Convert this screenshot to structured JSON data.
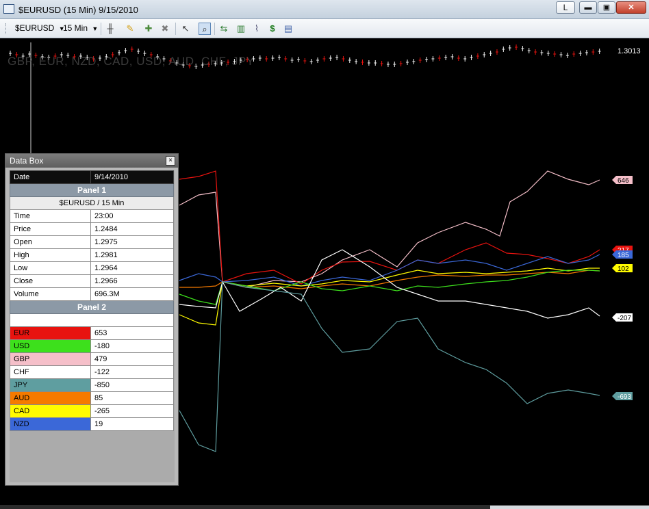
{
  "window": {
    "title": "$EURUSD (15 Min)  9/15/2010",
    "badge": "L",
    "minimize": "▬",
    "maximize": "▣",
    "close": "✕"
  },
  "toolbar": {
    "symbol": "$EURUSD",
    "interval": "15 Min",
    "icons": [
      "bar-style-icon",
      "pencil-icon",
      "add-indicator-icon",
      "remove-indicator-icon",
      "cursor-icon",
      "zoom-icon",
      "strategy-icon",
      "chart-analysis-icon",
      "line-chart-icon",
      "dollar-icon",
      "data-window-icon"
    ]
  },
  "chart": {
    "symbols_overlay": "GBP, EUR, NZD, CAD, USD, AUD, CHF, JPY",
    "price_label": "1.3013",
    "colors": {
      "EUR": "#e8130f",
      "USD": "#3de01c",
      "GBP": "#f5bfc9",
      "CHF": "#ffffff",
      "JPY": "#5f9ea0",
      "AUD": "#f57a00",
      "CAD": "#fffb00",
      "NZD": "#3b68d8"
    },
    "end_labels": [
      {
        "name": "GBP",
        "text": "646"
      },
      {
        "name": "EUR",
        "text": "217"
      },
      {
        "name": "NZD",
        "text": "185"
      },
      {
        "name": "CAD",
        "text": "102"
      },
      {
        "name": "CHF",
        "text": "-207"
      },
      {
        "name": "JPY",
        "text": "-693"
      }
    ]
  },
  "databox": {
    "title": "Data Box",
    "close": "×",
    "date_label": "Date",
    "date_value": "9/14/2010",
    "panel1": "Panel 1",
    "panel1_sub": "$EURUSD / 15 Min",
    "rows": [
      {
        "label": "Time",
        "value": "23:00"
      },
      {
        "label": "Price",
        "value": "1.2484"
      },
      {
        "label": "Open",
        "value": "1.2975"
      },
      {
        "label": "High",
        "value": "1.2981"
      },
      {
        "label": "Low",
        "value": "1.2964"
      },
      {
        "label": "Close",
        "value": "1.2966"
      },
      {
        "label": "Volume",
        "value": "696.3M"
      }
    ],
    "panel2": "Panel 2",
    "currencies": [
      {
        "label": "EUR",
        "value": "653",
        "color": "#e8130f"
      },
      {
        "label": "USD",
        "value": "-180",
        "color": "#3de01c"
      },
      {
        "label": "GBP",
        "value": "479",
        "color": "#f5bfc9"
      },
      {
        "label": "CHF",
        "value": "-122",
        "color": "#ffffff"
      },
      {
        "label": "JPY",
        "value": "-850",
        "color": "#5f9ea0"
      },
      {
        "label": "AUD",
        "value": "85",
        "color": "#f57a00"
      },
      {
        "label": "CAD",
        "value": "-265",
        "color": "#fffb00"
      },
      {
        "label": "NZD",
        "value": "19",
        "color": "#3b68d8"
      }
    ]
  }
}
